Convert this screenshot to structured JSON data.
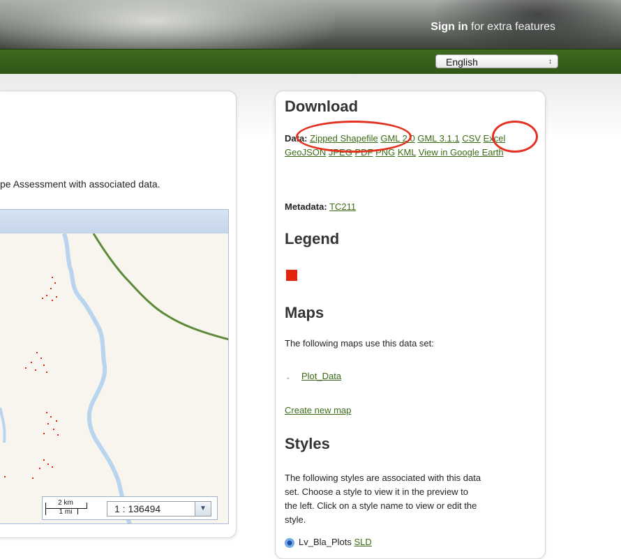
{
  "header": {
    "signin_link": "Sign in",
    "signin_suffix": "for extra features",
    "language": "English",
    "language_arrows": "↕"
  },
  "left": {
    "description_partial": "pe Assessment with associated data.",
    "scale": {
      "km": "2 km",
      "mi": "1 mi",
      "ratio": "1 : 136494"
    }
  },
  "download": {
    "heading": "Download",
    "data_label": "Data:",
    "links": [
      "Zipped Shapefile",
      "GML 2.0",
      "GML 3.1.1",
      "CSV",
      "Excel",
      "GeoJSON",
      "JPEG",
      "PDF",
      "PNG",
      "KML",
      "View in Google Earth"
    ],
    "metadata_label": "Metadata:",
    "metadata_link": "TC211"
  },
  "legend": {
    "heading": "Legend",
    "swatch_color": "#e2230e"
  },
  "maps": {
    "heading": "Maps",
    "intro": "The following maps use this data set:",
    "items": [
      "Plot_Data"
    ],
    "create_link": "Create new map"
  },
  "styles": {
    "heading": "Styles",
    "intro_lines": [
      "The following styles are associated with this data",
      "set. Choose a style to view it in the preview to",
      "the left. Click on a style name to view or edit the",
      "style."
    ],
    "items": [
      {
        "name": "Lv_Bla_Plots",
        "sld": "SLD"
      }
    ]
  },
  "colors": {
    "accent_green": "#3b6b16",
    "annotation_red": "#e3311f",
    "header_green": "#2e5616"
  }
}
